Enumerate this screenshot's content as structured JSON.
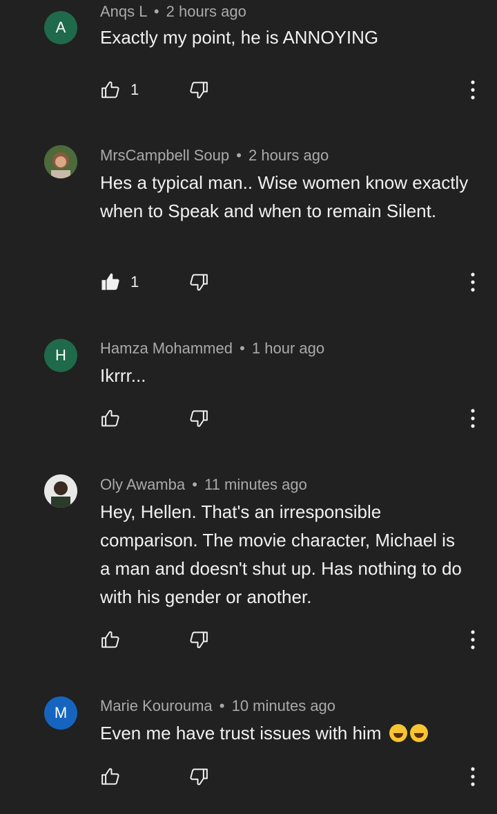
{
  "comments": [
    {
      "avatar_letter": "A",
      "avatar_color": "#1f6a4a",
      "author": "Anqs L",
      "time": "2 hours ago",
      "text": "Exactly my point, he is ANNOYING",
      "likes": "1",
      "liked": false
    },
    {
      "avatar_letter": "",
      "avatar_color": "#6b7a5a",
      "avatar_icon": "user-photo-icon",
      "author": "MrsCampbell Soup",
      "time": "2 hours ago",
      "text": "Hes a typical man.. Wise women know exactly when to Speak and when to remain Silent.",
      "likes": "1",
      "liked": true
    },
    {
      "avatar_letter": "H",
      "avatar_color": "#1f6a4a",
      "author": "Hamza Mohammed",
      "time": "1 hour ago",
      "text": "Ikrrr...",
      "likes": "",
      "liked": false
    },
    {
      "avatar_letter": "",
      "avatar_color": "#5a5a5a",
      "avatar_icon": "user-photo-icon",
      "author": "Oly Awamba",
      "time": "11 minutes ago",
      "text": "Hey, Hellen. That's an irresponsible comparison. The movie character, Michael is a man and doesn't shut up. Has nothing to do with his gender or another.",
      "likes": "",
      "liked": false
    },
    {
      "avatar_letter": "M",
      "avatar_color": "#1565c0",
      "author": "Marie Kourouma",
      "time": "10 minutes ago",
      "text": "Even me have trust issues with him",
      "emoji": "rolling-on-floor-laughing-icon",
      "likes": "",
      "liked": false
    }
  ],
  "separator": "•"
}
